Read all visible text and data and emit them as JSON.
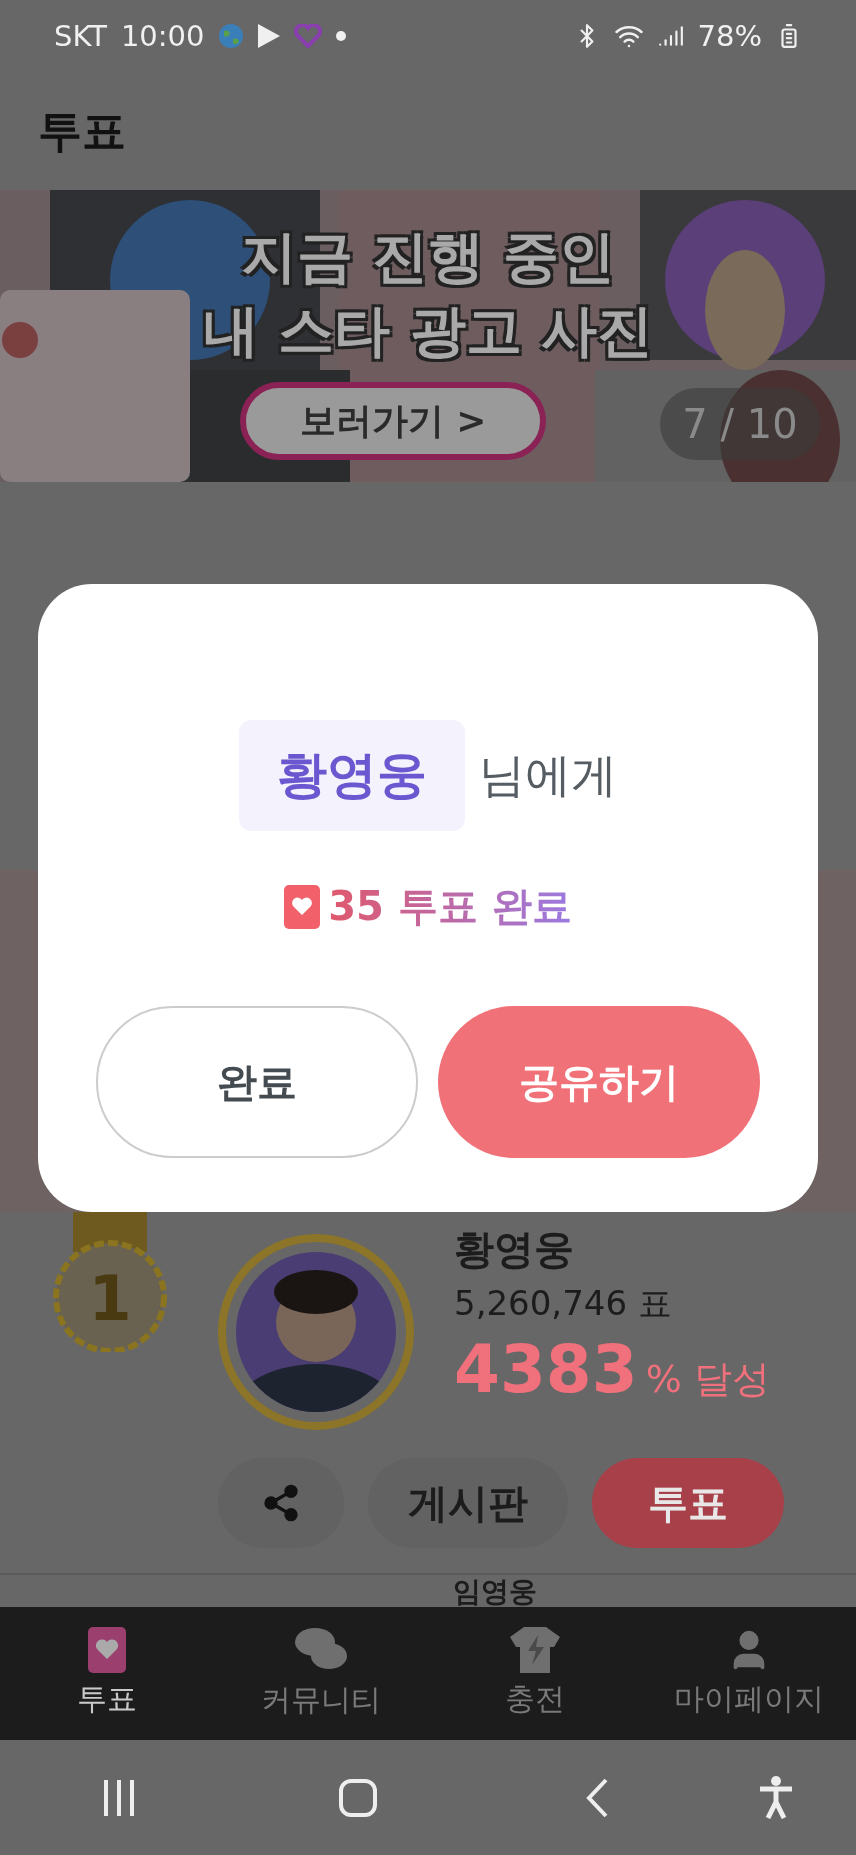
{
  "status_bar": {
    "carrier": "SKT",
    "time": "10:00",
    "battery": "78%"
  },
  "app_bar": {
    "title": "투표"
  },
  "banner": {
    "headline": [
      "지금 진행 중인",
      "내 스타 광고 사진"
    ],
    "button": "보러가기 >",
    "counter": "7 / 10"
  },
  "ranking": [
    {
      "rank": "1",
      "name": "황영웅",
      "votes": "5,260,746 표",
      "percent": "4383",
      "percent_suffix": "% 달성",
      "board_button": "게시판",
      "vote_button": "투표"
    },
    {
      "name": "임영웅"
    }
  ],
  "dialog": {
    "name": "황영웅",
    "suffix": "님에게",
    "result": "35 투표 완료",
    "buttons": [
      {
        "label": "완료",
        "kind": "outline"
      },
      {
        "label": "공유하기",
        "kind": "primary"
      }
    ]
  },
  "bottom_nav": [
    {
      "label": "투표",
      "selected": true
    },
    {
      "label": "커뮤니티",
      "selected": false
    },
    {
      "label": "충전",
      "selected": false
    },
    {
      "label": "마이페이지",
      "selected": false
    }
  ]
}
